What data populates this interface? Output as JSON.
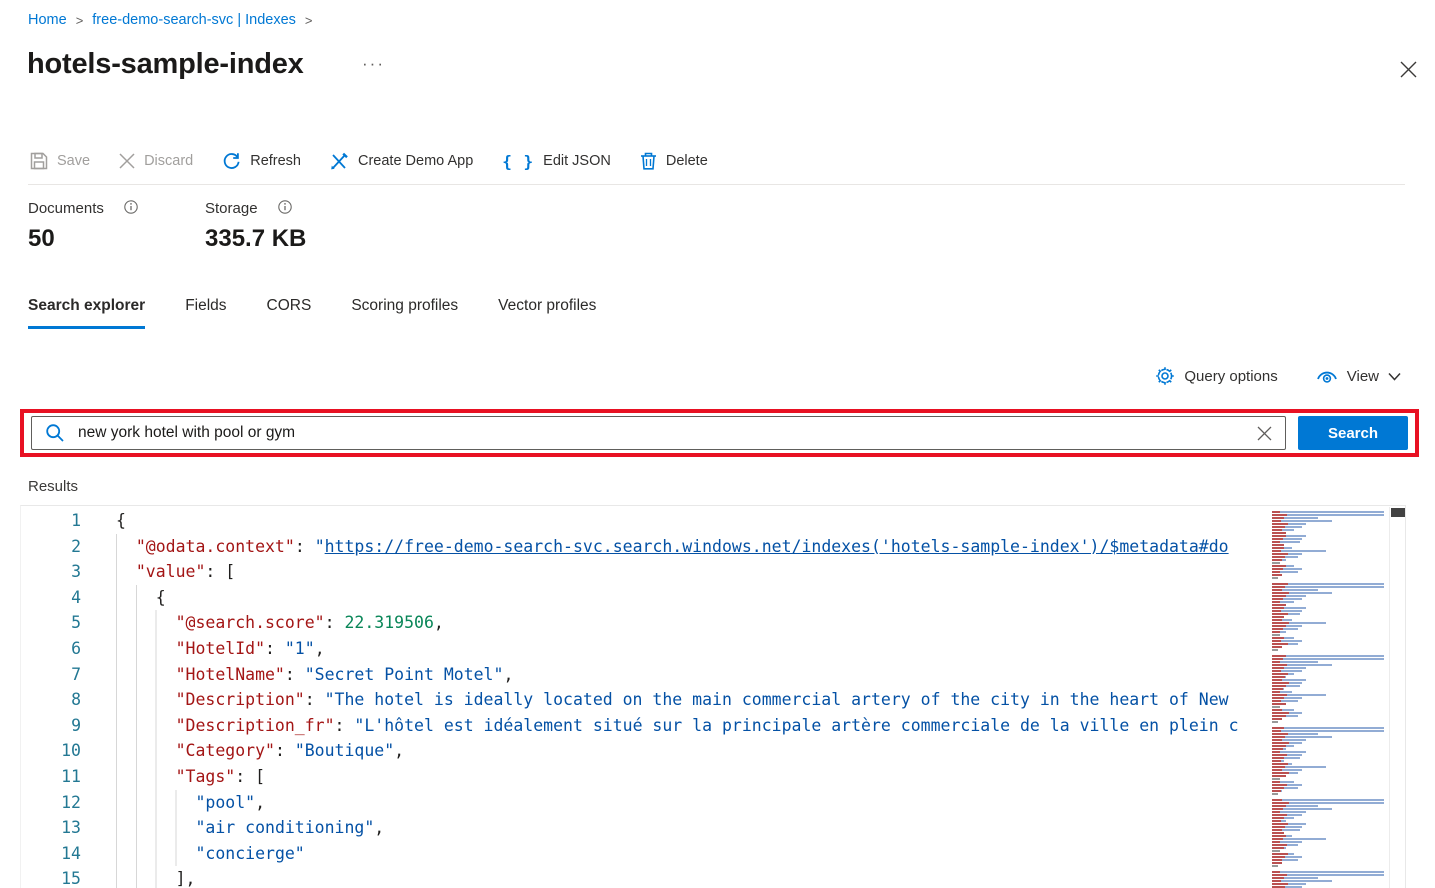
{
  "breadcrumb": {
    "home": "Home",
    "separator": ">",
    "service": "free-demo-search-svc | Indexes"
  },
  "header": {
    "title": "hotels-sample-index",
    "ellipsis": "···"
  },
  "toolbar": {
    "save": "Save",
    "discard": "Discard",
    "refresh": "Refresh",
    "create_demo_app": "Create Demo App",
    "edit_json": "Edit JSON",
    "edit_json_icon": "{ }",
    "delete": "Delete"
  },
  "stats": {
    "documents_label": "Documents",
    "documents_value": "50",
    "storage_label": "Storage",
    "storage_value": "335.7 KB"
  },
  "tabs": [
    {
      "label": "Search explorer",
      "active": true
    },
    {
      "label": "Fields",
      "active": false
    },
    {
      "label": "CORS",
      "active": false
    },
    {
      "label": "Scoring profiles",
      "active": false
    },
    {
      "label": "Vector profiles",
      "active": false
    }
  ],
  "options": {
    "query_options": "Query options",
    "view": "View"
  },
  "search": {
    "query": "new york hotel with pool or gym",
    "button_label": "Search"
  },
  "results_label": "Results",
  "editor": {
    "lines": [
      {
        "n": "1",
        "indent": 0,
        "segments": [
          {
            "t": "{",
            "c": "p"
          }
        ]
      },
      {
        "n": "2",
        "indent": 1,
        "segments": [
          {
            "t": "\"@odata.context\"",
            "c": "k"
          },
          {
            "t": ": ",
            "c": "p"
          },
          {
            "t": "\"",
            "c": "s"
          },
          {
            "t": "https://free-demo-search-svc.search.windows.net/indexes('hotels-sample-index')/$metadata#do",
            "c": "u"
          }
        ]
      },
      {
        "n": "3",
        "indent": 1,
        "segments": [
          {
            "t": "\"value\"",
            "c": "k"
          },
          {
            "t": ": [",
            "c": "p"
          }
        ]
      },
      {
        "n": "4",
        "indent": 2,
        "segments": [
          {
            "t": "{",
            "c": "p"
          }
        ]
      },
      {
        "n": "5",
        "indent": 3,
        "segments": [
          {
            "t": "\"@search.score\"",
            "c": "k"
          },
          {
            "t": ": ",
            "c": "p"
          },
          {
            "t": "22.319506",
            "c": "n"
          },
          {
            "t": ",",
            "c": "p"
          }
        ]
      },
      {
        "n": "6",
        "indent": 3,
        "segments": [
          {
            "t": "\"HotelId\"",
            "c": "k"
          },
          {
            "t": ": ",
            "c": "p"
          },
          {
            "t": "\"1\"",
            "c": "s"
          },
          {
            "t": ",",
            "c": "p"
          }
        ]
      },
      {
        "n": "7",
        "indent": 3,
        "segments": [
          {
            "t": "\"HotelName\"",
            "c": "k"
          },
          {
            "t": ": ",
            "c": "p"
          },
          {
            "t": "\"Secret Point Motel\"",
            "c": "s"
          },
          {
            "t": ",",
            "c": "p"
          }
        ]
      },
      {
        "n": "8",
        "indent": 3,
        "segments": [
          {
            "t": "\"Description\"",
            "c": "k"
          },
          {
            "t": ": ",
            "c": "p"
          },
          {
            "t": "\"The hotel is ideally located on the main commercial artery of the city in the heart of New",
            "c": "s"
          }
        ]
      },
      {
        "n": "9",
        "indent": 3,
        "segments": [
          {
            "t": "\"Description_fr\"",
            "c": "k"
          },
          {
            "t": ": ",
            "c": "p"
          },
          {
            "t": "\"L'hôtel est idéalement situé sur la principale artère commerciale de la ville en plein c",
            "c": "s"
          }
        ]
      },
      {
        "n": "10",
        "indent": 3,
        "segments": [
          {
            "t": "\"Category\"",
            "c": "k"
          },
          {
            "t": ": ",
            "c": "p"
          },
          {
            "t": "\"Boutique\"",
            "c": "s"
          },
          {
            "t": ",",
            "c": "p"
          }
        ]
      },
      {
        "n": "11",
        "indent": 3,
        "segments": [
          {
            "t": "\"Tags\"",
            "c": "k"
          },
          {
            "t": ": [",
            "c": "p"
          }
        ]
      },
      {
        "n": "12",
        "indent": 4,
        "segments": [
          {
            "t": "\"pool\"",
            "c": "s"
          },
          {
            "t": ",",
            "c": "p"
          }
        ]
      },
      {
        "n": "13",
        "indent": 4,
        "segments": [
          {
            "t": "\"air conditioning\"",
            "c": "s"
          },
          {
            "t": ",",
            "c": "p"
          }
        ]
      },
      {
        "n": "14",
        "indent": 4,
        "segments": [
          {
            "t": "\"concierge\"",
            "c": "s"
          }
        ]
      },
      {
        "n": "15",
        "indent": 3,
        "segments": [
          {
            "t": "],",
            "c": "p"
          }
        ]
      }
    ]
  },
  "colors": {
    "accent": "#0078d4",
    "annotation_red": "#e81123",
    "json_key": "#a31515",
    "json_string": "#0451a5",
    "json_number": "#098658",
    "line_number": "#237893"
  }
}
